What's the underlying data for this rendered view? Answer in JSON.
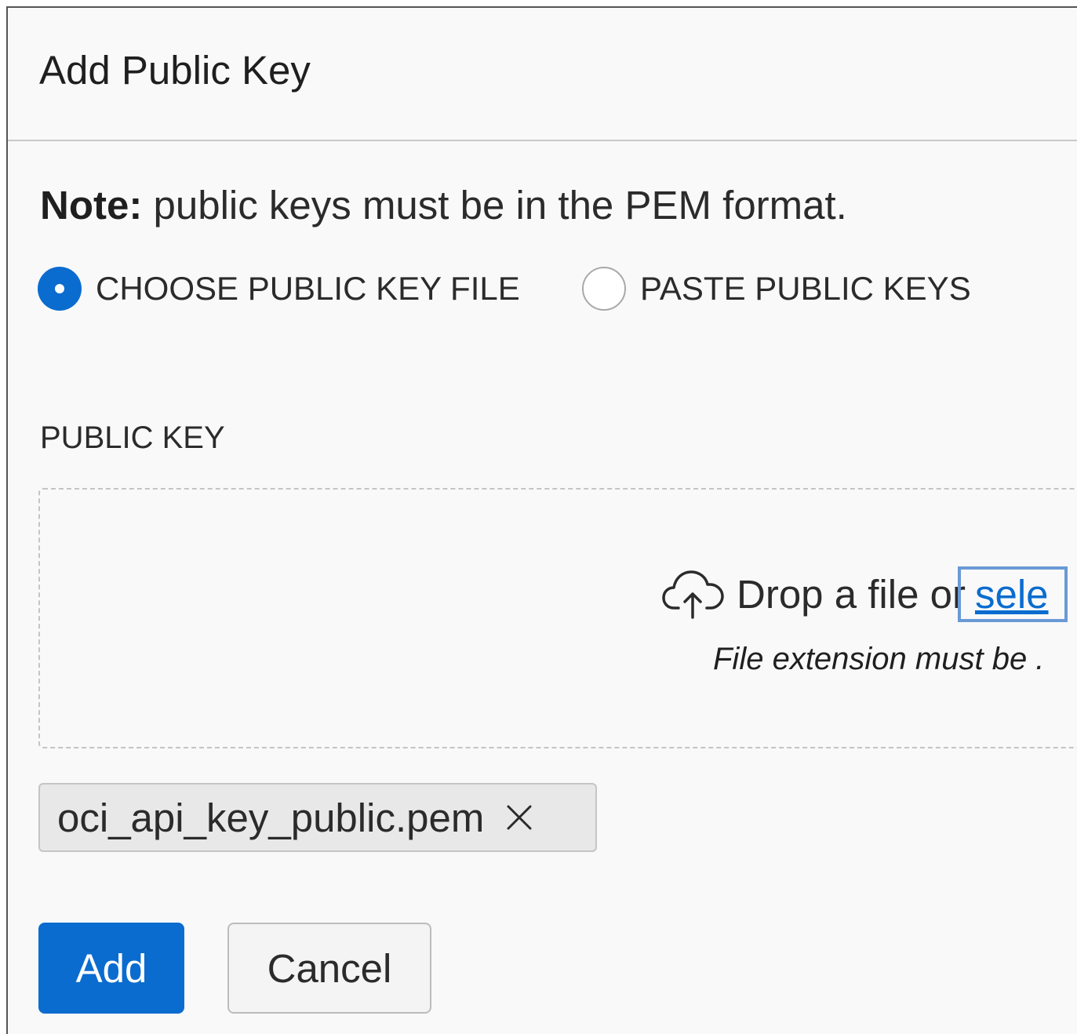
{
  "dialog": {
    "title": "Add Public Key"
  },
  "note": {
    "label": "Note:",
    "text": " public keys must be in the PEM format."
  },
  "key_source": {
    "options": [
      {
        "label": "CHOOSE PUBLIC KEY FILE",
        "selected": true
      },
      {
        "label": "PASTE PUBLIC KEYS",
        "selected": false
      }
    ]
  },
  "public_key": {
    "label": "PUBLIC KEY",
    "drop_text": "Drop a file or",
    "select_link": "sele",
    "hint": "File extension must be ."
  },
  "selected_file": {
    "name": "oci_api_key_public.pem"
  },
  "actions": {
    "add_label": "Add",
    "cancel_label": "Cancel"
  },
  "colors": {
    "primary": "#0a6ccf",
    "chip_background": "#e8e8e8",
    "dialog_background": "#f9f9f9"
  },
  "icons": {
    "upload": "cloud-upload-icon",
    "remove": "close-icon"
  }
}
